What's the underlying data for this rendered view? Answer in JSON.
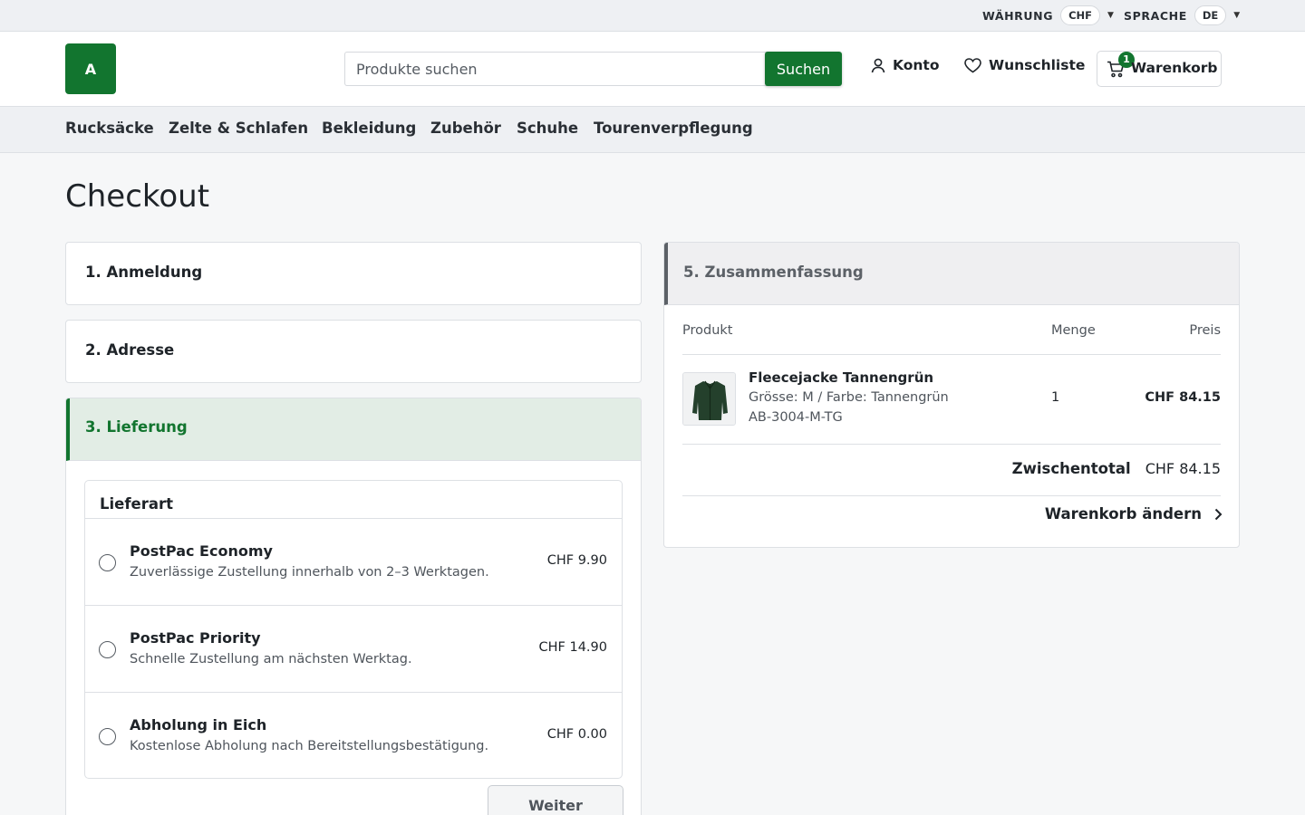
{
  "topbar": {
    "currency_label": "WÄHRUNG",
    "currency_value": "CHF",
    "language_label": "SPRACHE",
    "language_value": "DE"
  },
  "header": {
    "logo_text": "A",
    "search_placeholder": "Produkte suchen",
    "search_button": "Suchen",
    "account": "Konto",
    "wishlist": "Wunschliste",
    "cart_label": "Warenkorb",
    "cart_count": "1"
  },
  "categories": [
    "Rucksäcke",
    "Zelte & Schlafen",
    "Bekleidung",
    "Zubehör",
    "Schuhe",
    "Tourenverpflegung"
  ],
  "page_title": "Checkout",
  "steps": {
    "login": "1. Anmeldung",
    "address": "2. Adresse",
    "delivery": "3. Lieferung",
    "summary": "5. Zusammenfassung"
  },
  "delivery": {
    "box_title": "Lieferart",
    "options": [
      {
        "name": "PostPac Economy",
        "desc": "Zuverlässige Zustellung innerhalb von 2–3 Werktagen.",
        "price": "CHF 9.90"
      },
      {
        "name": "PostPac Priority",
        "desc": "Schnelle Zustellung am nächsten Werktag.",
        "price": "CHF 14.90"
      },
      {
        "name": "Abholung in Eich",
        "desc": "Kostenlose Abholung nach Bereitstellungsbestätigung.",
        "price": "CHF 0.00"
      }
    ],
    "continue_button": "Weiter"
  },
  "summary": {
    "col_product": "Produkt",
    "col_qty": "Menge",
    "col_price": "Preis",
    "item": {
      "name": "Fleecejacke Tannengrün",
      "variant": "Grösse: M / Farbe: Tannengrün",
      "sku": "AB-3004-M-TG",
      "qty": "1",
      "price": "CHF 84.15"
    },
    "subtotal_label": "Zwischentotal",
    "subtotal_value": "CHF 84.15",
    "edit_cart": "Warenkorb ändern"
  },
  "colors": {
    "brand_green": "#12752f",
    "active_step_bg": "#e2ede5"
  }
}
